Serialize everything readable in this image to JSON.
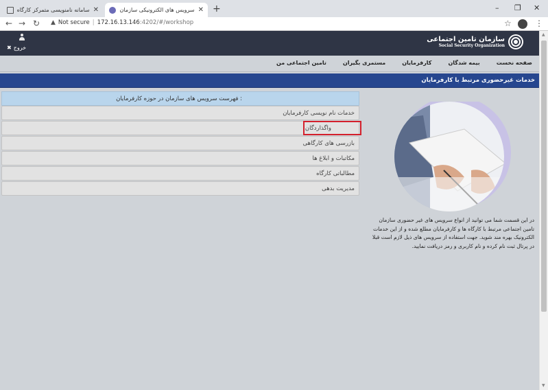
{
  "browser": {
    "tabs": [
      {
        "title": "سامانه نامنویسی متمرکز کارگاه و بیمه شده"
      },
      {
        "title": "سرویس های الکترونیکی سازمان تامین"
      }
    ],
    "new_tab": "+",
    "close_glyph": "✕",
    "security_label": "Not secure",
    "url_host": "172.16.13.146",
    "url_rest": ":4202/#/workshop"
  },
  "site": {
    "org_name_fa": "سازمان تامین اجتماعی",
    "org_name_en": "Social Security Organization",
    "logout_label": "خروج",
    "menu": [
      {
        "label": "صفحه نخست"
      },
      {
        "label": "بیمه شدگان"
      },
      {
        "label": "کارفرمایان"
      },
      {
        "label": "مستمری بگیران"
      },
      {
        "label": "تامین اجتماعی من"
      }
    ],
    "banner_title": "خدمات غیرحضوری مرتبط با کارفرمایان",
    "services_header": "فهرست سرویس های سازمان در حوزه کارفرمایان :",
    "services": [
      {
        "label": "خدمات نام نویسی کارفرمایان"
      },
      {
        "label": "واگذاردگان"
      },
      {
        "label": "بازرسی های کارگاهی"
      },
      {
        "label": "مکاتبات و ابلاغ ها"
      },
      {
        "label": "مطالباتی کارگاه"
      },
      {
        "label": "مدیریت بدهی"
      }
    ],
    "description": "در این قسمت شما می توانید از انواع سرویس های غیر حضوری سازمان تامین اجتماعی مرتبط با کارگاه ها و کارفرمایان مطلع شده و از این خدمات الکترونیک بهره مند شوید. جهت استفاده از سرویس های ذیل لازم است قبلا در پرتال ثبت نام کرده و نام کاربری و رمز دریافت نمایید."
  },
  "colors": {
    "header_bg": "#2f3545",
    "banner_bg": "#26468f",
    "services_header_bg": "#b9d5ec",
    "highlight_border": "#d4202c"
  }
}
